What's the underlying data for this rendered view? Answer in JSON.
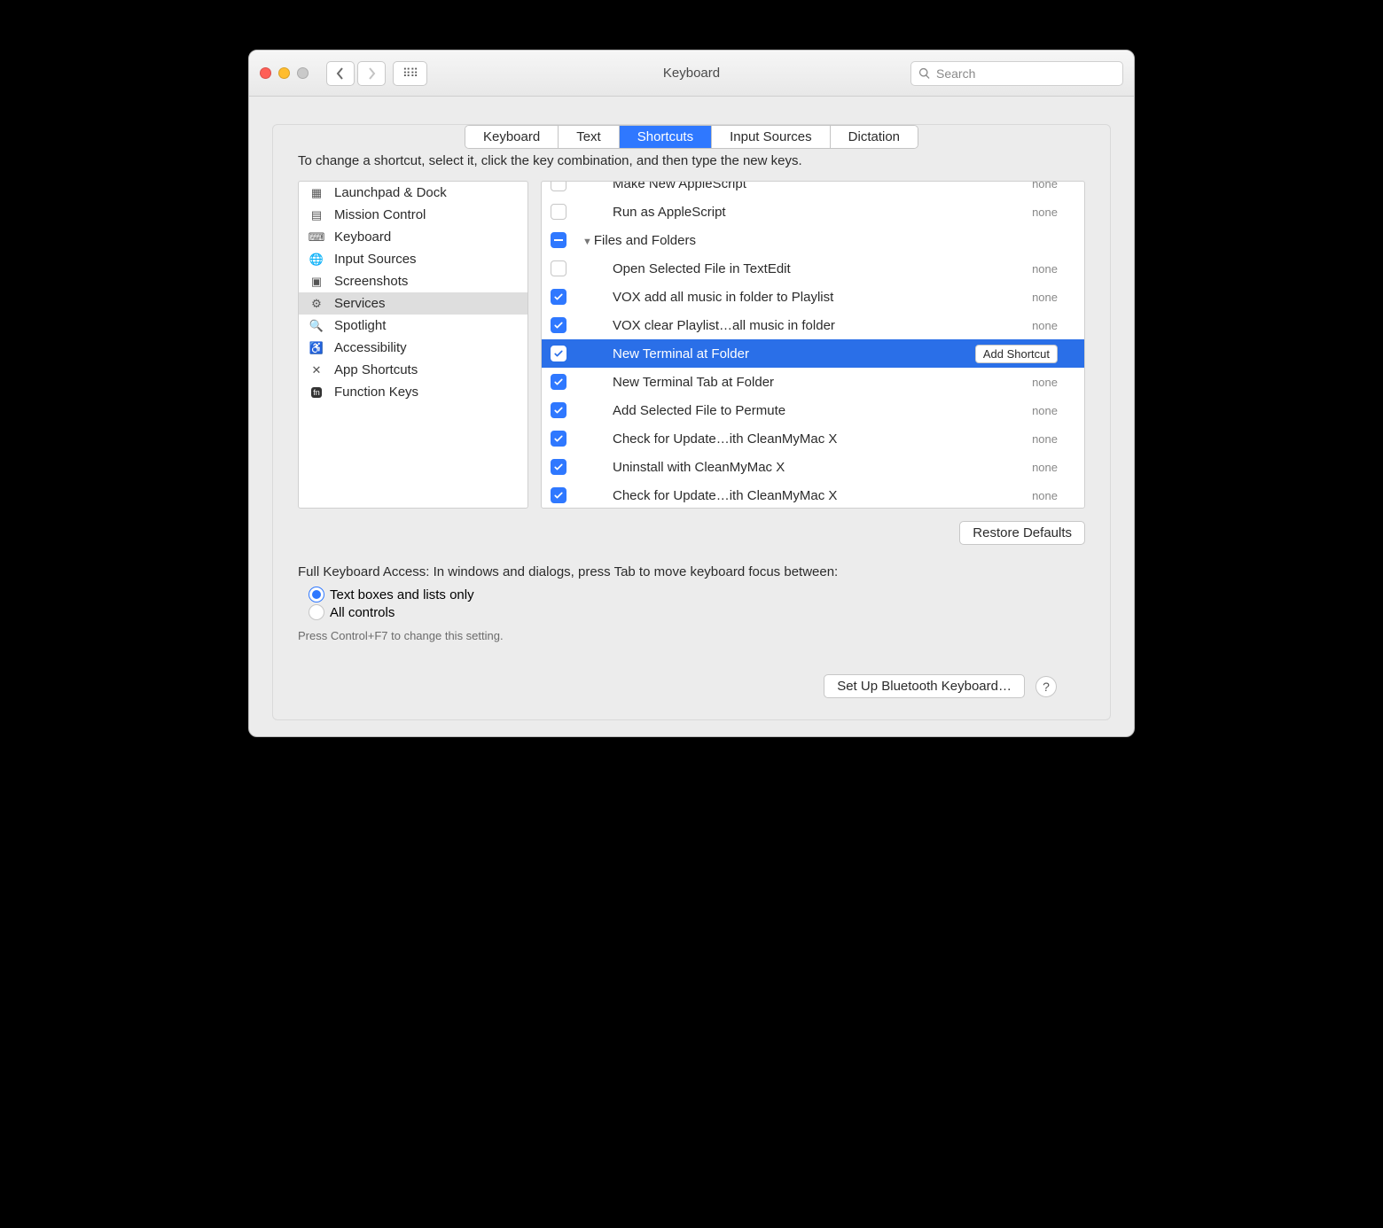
{
  "window": {
    "title": "Keyboard",
    "search_placeholder": "Search"
  },
  "tabs": [
    {
      "label": "Keyboard",
      "active": false
    },
    {
      "label": "Text",
      "active": false
    },
    {
      "label": "Shortcuts",
      "active": true
    },
    {
      "label": "Input Sources",
      "active": false
    },
    {
      "label": "Dictation",
      "active": false
    }
  ],
  "hint": "To change a shortcut, select it, click the key combination, and then type the new keys.",
  "sidebar": {
    "items": [
      {
        "label": "Launchpad & Dock",
        "selected": false
      },
      {
        "label": "Mission Control",
        "selected": false
      },
      {
        "label": "Keyboard",
        "selected": false
      },
      {
        "label": "Input Sources",
        "selected": false
      },
      {
        "label": "Screenshots",
        "selected": false
      },
      {
        "label": "Services",
        "selected": true
      },
      {
        "label": "Spotlight",
        "selected": false
      },
      {
        "label": "Accessibility",
        "selected": false
      },
      {
        "label": "App Shortcuts",
        "selected": false
      },
      {
        "label": "Function Keys",
        "selected": false
      }
    ]
  },
  "shortcuts": {
    "rows": [
      {
        "type": "item",
        "checked": false,
        "label": "Make New AppleScript",
        "shortcut": "none",
        "selected": false
      },
      {
        "type": "item",
        "checked": false,
        "label": "Run as AppleScript",
        "shortcut": "none",
        "selected": false
      },
      {
        "type": "group",
        "checked": "mixed",
        "label": "Files and Folders",
        "selected": false
      },
      {
        "type": "item",
        "checked": false,
        "label": "Open Selected File in TextEdit",
        "shortcut": "none",
        "selected": false
      },
      {
        "type": "item",
        "checked": true,
        "label": "VOX add all music in folder to Playlist",
        "shortcut": "none",
        "selected": false
      },
      {
        "type": "item",
        "checked": true,
        "label": "VOX clear Playlist…all music in folder",
        "shortcut": "none",
        "selected": false
      },
      {
        "type": "item",
        "checked": true,
        "label": "New Terminal at Folder",
        "shortcut": "add",
        "selected": true
      },
      {
        "type": "item",
        "checked": true,
        "label": "New Terminal Tab at Folder",
        "shortcut": "none",
        "selected": false
      },
      {
        "type": "item",
        "checked": true,
        "label": "Add Selected File to Permute",
        "shortcut": "none",
        "selected": false
      },
      {
        "type": "item",
        "checked": true,
        "label": "Check for Update…ith CleanMyMac X",
        "shortcut": "none",
        "selected": false
      },
      {
        "type": "item",
        "checked": true,
        "label": "Uninstall with CleanMyMac X",
        "shortcut": "none",
        "selected": false
      },
      {
        "type": "item",
        "checked": true,
        "label": "Check for Update…ith CleanMyMac X",
        "shortcut": "none",
        "selected": false
      }
    ],
    "add_shortcut_label": "Add Shortcut",
    "none_label": "none"
  },
  "buttons": {
    "restore_defaults": "Restore Defaults",
    "setup_bluetooth": "Set Up Bluetooth Keyboard…"
  },
  "fka": {
    "heading": "Full Keyboard Access: In windows and dialogs, press Tab to move keyboard focus between:",
    "option1": "Text boxes and lists only",
    "option2": "All controls",
    "footnote": "Press Control+F7 to change this setting."
  }
}
